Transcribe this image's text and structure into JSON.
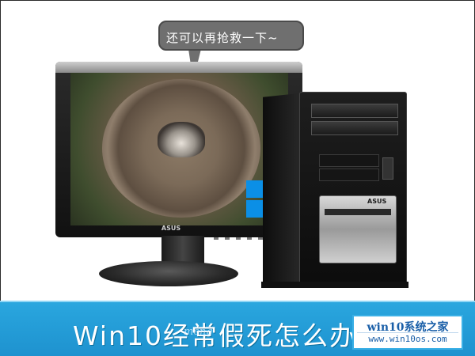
{
  "bubble": {
    "text": "还可以再抢救一下~"
  },
  "monitor": {
    "brand": "ASUS"
  },
  "tower": {
    "brand": "ASUS"
  },
  "banner": {
    "title": "Win10经常假死怎么办"
  },
  "watermark": {
    "line1": "win10系统之家",
    "line2": "www.win10os.com"
  },
  "colors": {
    "banner": "#1e92cf",
    "bubble": "#6f6f6f",
    "windows_logo": "#0b8fe6"
  }
}
